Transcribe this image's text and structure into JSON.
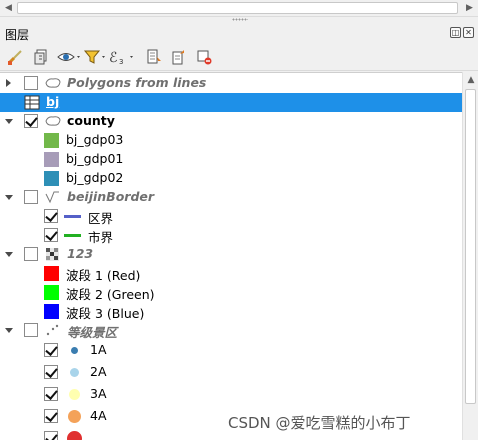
{
  "panel": {
    "title": "图层"
  },
  "toolbar": {
    "items": [
      {
        "icon": "paint-brush-icon"
      },
      {
        "icon": "add-group-icon"
      },
      {
        "icon": "eye-icon"
      },
      {
        "icon": "filter-icon"
      },
      {
        "icon": "expression-filter-icon"
      },
      {
        "icon": "expand-all-icon"
      },
      {
        "icon": "collapse-all-icon"
      },
      {
        "icon": "remove-layer-icon"
      }
    ]
  },
  "layers": {
    "polygons_from_lines": "Polygons from lines",
    "bj": "bj",
    "county": "county",
    "county_classes": [
      "bj_gdp03",
      "bj_gdp01",
      "bj_gdp02"
    ],
    "county_colors": [
      "#72b84a",
      "#a79cb8",
      "#2e8fb6"
    ],
    "beijin_border": "beijinBorder",
    "border_classes": [
      "区界",
      "市界"
    ],
    "border_colors": [
      "#5560c8",
      "#22b022"
    ],
    "raster_123": "123",
    "bands": [
      "波段 1 (Red)",
      "波段 2 (Green)",
      "波段 3 (Blue)"
    ],
    "band_colors": [
      "#ff0000",
      "#00ff00",
      "#0000ff"
    ],
    "scenic": "等级景区",
    "scenic_classes": [
      "1A",
      "2A",
      "3A",
      "4A"
    ],
    "scenic_colors": [
      "#3b7db0",
      "#a9d4ea",
      "#ffffb0",
      "#f4a259",
      "#e03030"
    ]
  },
  "watermark": "CSDN @爱吃雪糕的小布丁"
}
